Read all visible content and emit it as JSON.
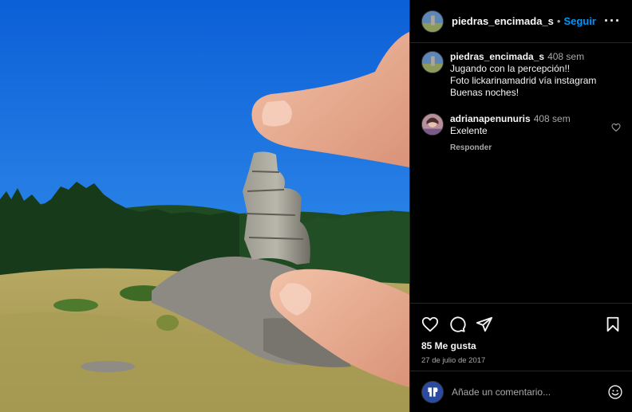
{
  "post": {
    "username": "piedras_encimada_s",
    "separator": "•",
    "follow_label": "Seguir",
    "more_label": "···"
  },
  "comments": [
    {
      "username": "piedras_encimada_s",
      "time": "408 sem",
      "lines": [
        "Jugando con la percepción!!",
        "Foto lickarinamadrid vía instagram",
        "Buenas noches!"
      ]
    },
    {
      "username": "adrianapenunuris",
      "time": "408 sem",
      "lines": [
        "Exelente"
      ],
      "reply_label": "Responder"
    }
  ],
  "engagement": {
    "likes": "85 Me gusta",
    "date": "27 de julio de 2017"
  },
  "composer": {
    "placeholder": "Añade un comentario..."
  },
  "icons": {
    "like": "heart-icon",
    "comment": "comment-bubble-icon",
    "share": "paper-plane-icon",
    "save": "bookmark-icon",
    "emoji": "smiley-icon",
    "more": "more-options-icon"
  },
  "colors": {
    "accent": "#0095f6",
    "background": "#000000",
    "secondary_text": "#a8a8a8",
    "divider": "#262626"
  }
}
